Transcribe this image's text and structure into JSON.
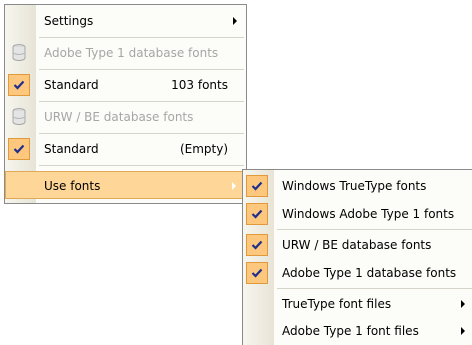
{
  "main_menu": {
    "settings": "Settings",
    "adobe_header": "Adobe Type 1 database fonts",
    "adobe_standard": "Standard",
    "adobe_standard_count": "103 fonts",
    "urw_header": "URW / BE database fonts",
    "urw_standard": "Standard",
    "urw_standard_count": "(Empty)",
    "use_fonts": "Use fonts"
  },
  "sub_menu": {
    "windows_truetype": "Windows TrueType fonts",
    "windows_adobe_type1": "Windows Adobe Type 1 fonts",
    "urw_be_database": "URW / BE database fonts",
    "adobe_type1_database": "Adobe Type 1 database fonts",
    "truetype_files": "TrueType font files",
    "adobe_type1_files": "Adobe Type 1 font files"
  },
  "colors": {
    "highlight": "#fdd698",
    "check_bg": "#fdc77e",
    "check_mark": "#1f2f8c"
  }
}
